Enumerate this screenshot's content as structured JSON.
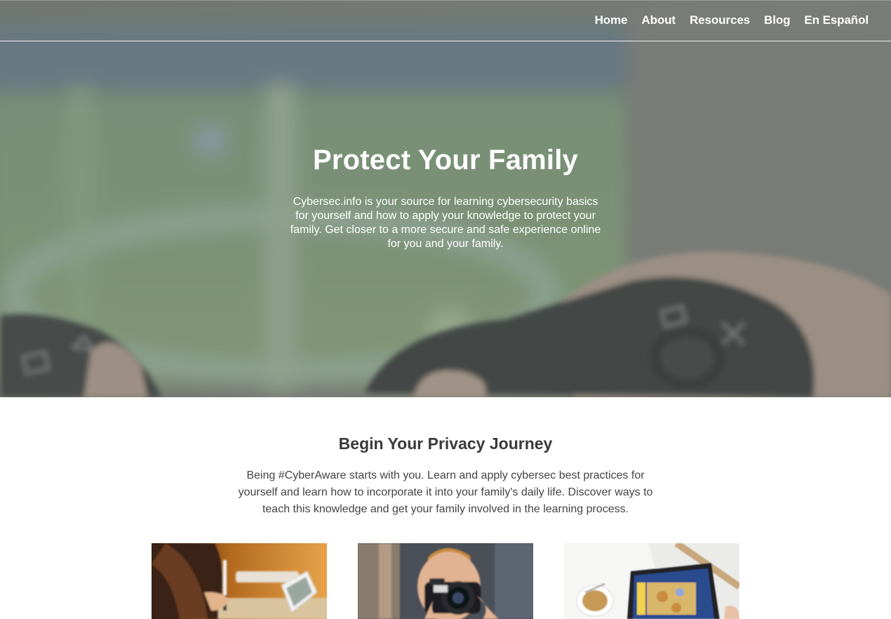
{
  "nav": {
    "items": [
      {
        "label": "Home"
      },
      {
        "label": "About"
      },
      {
        "label": "Resources"
      },
      {
        "label": "Blog"
      },
      {
        "label": "En Español"
      }
    ]
  },
  "hero": {
    "title": "Protect Your Family",
    "description": "Cybersec.info is your source for learning cybersecurity basics for yourself and how to apply your knowledge to protect your family. Get closer to a more secure and safe experience online for you and your family."
  },
  "journey": {
    "title": "Begin Your Privacy Journey",
    "description": "Being #CyberAware starts with you. Learn and apply cybersec best practices for yourself and learn how to incorporate it into your family's daily life. Discover ways to teach this knowledge and get your family involved in the learning process."
  },
  "colors": {
    "nav_text": "#ffffff",
    "hero_text": "#ffffff",
    "heading": "#3a3a3a",
    "body_text": "#444444"
  }
}
